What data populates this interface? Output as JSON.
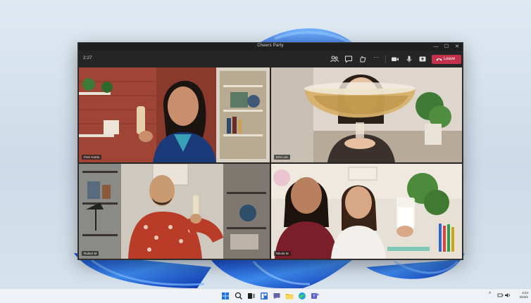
{
  "window": {
    "title": "Cheers Party",
    "controls": {
      "minimize": "—",
      "maximize": "☐",
      "close": "✕"
    }
  },
  "toolbar": {
    "timer": "2:27",
    "icons": [
      "people-icon",
      "chat-icon",
      "react-icon",
      "more-icon",
      "camera-icon",
      "mic-icon",
      "share-icon"
    ],
    "more_label": "···",
    "leave_label": "Leave",
    "leave_color": "#c4314b"
  },
  "participants": [
    {
      "name": "Pam Kanla"
    },
    {
      "name": "Erin Lee"
    },
    {
      "name": "Ruben M"
    },
    {
      "name": "Nikola M"
    }
  ],
  "taskbar": {
    "apps": [
      "windows-start-icon",
      "search-icon",
      "task-view-icon",
      "widgets-icon",
      "teams-chat-icon",
      "file-explorer-icon",
      "edge-icon",
      "store-icon",
      "teams-icon"
    ],
    "tray": {
      "chevron": "^",
      "clock_time": "4:24",
      "clock_date": "4/24/1"
    }
  },
  "colors": {
    "accent_wallpaper": "#2f6fe0",
    "window_bg": "#252525",
    "taskbar_bg": "#eef1f5"
  }
}
